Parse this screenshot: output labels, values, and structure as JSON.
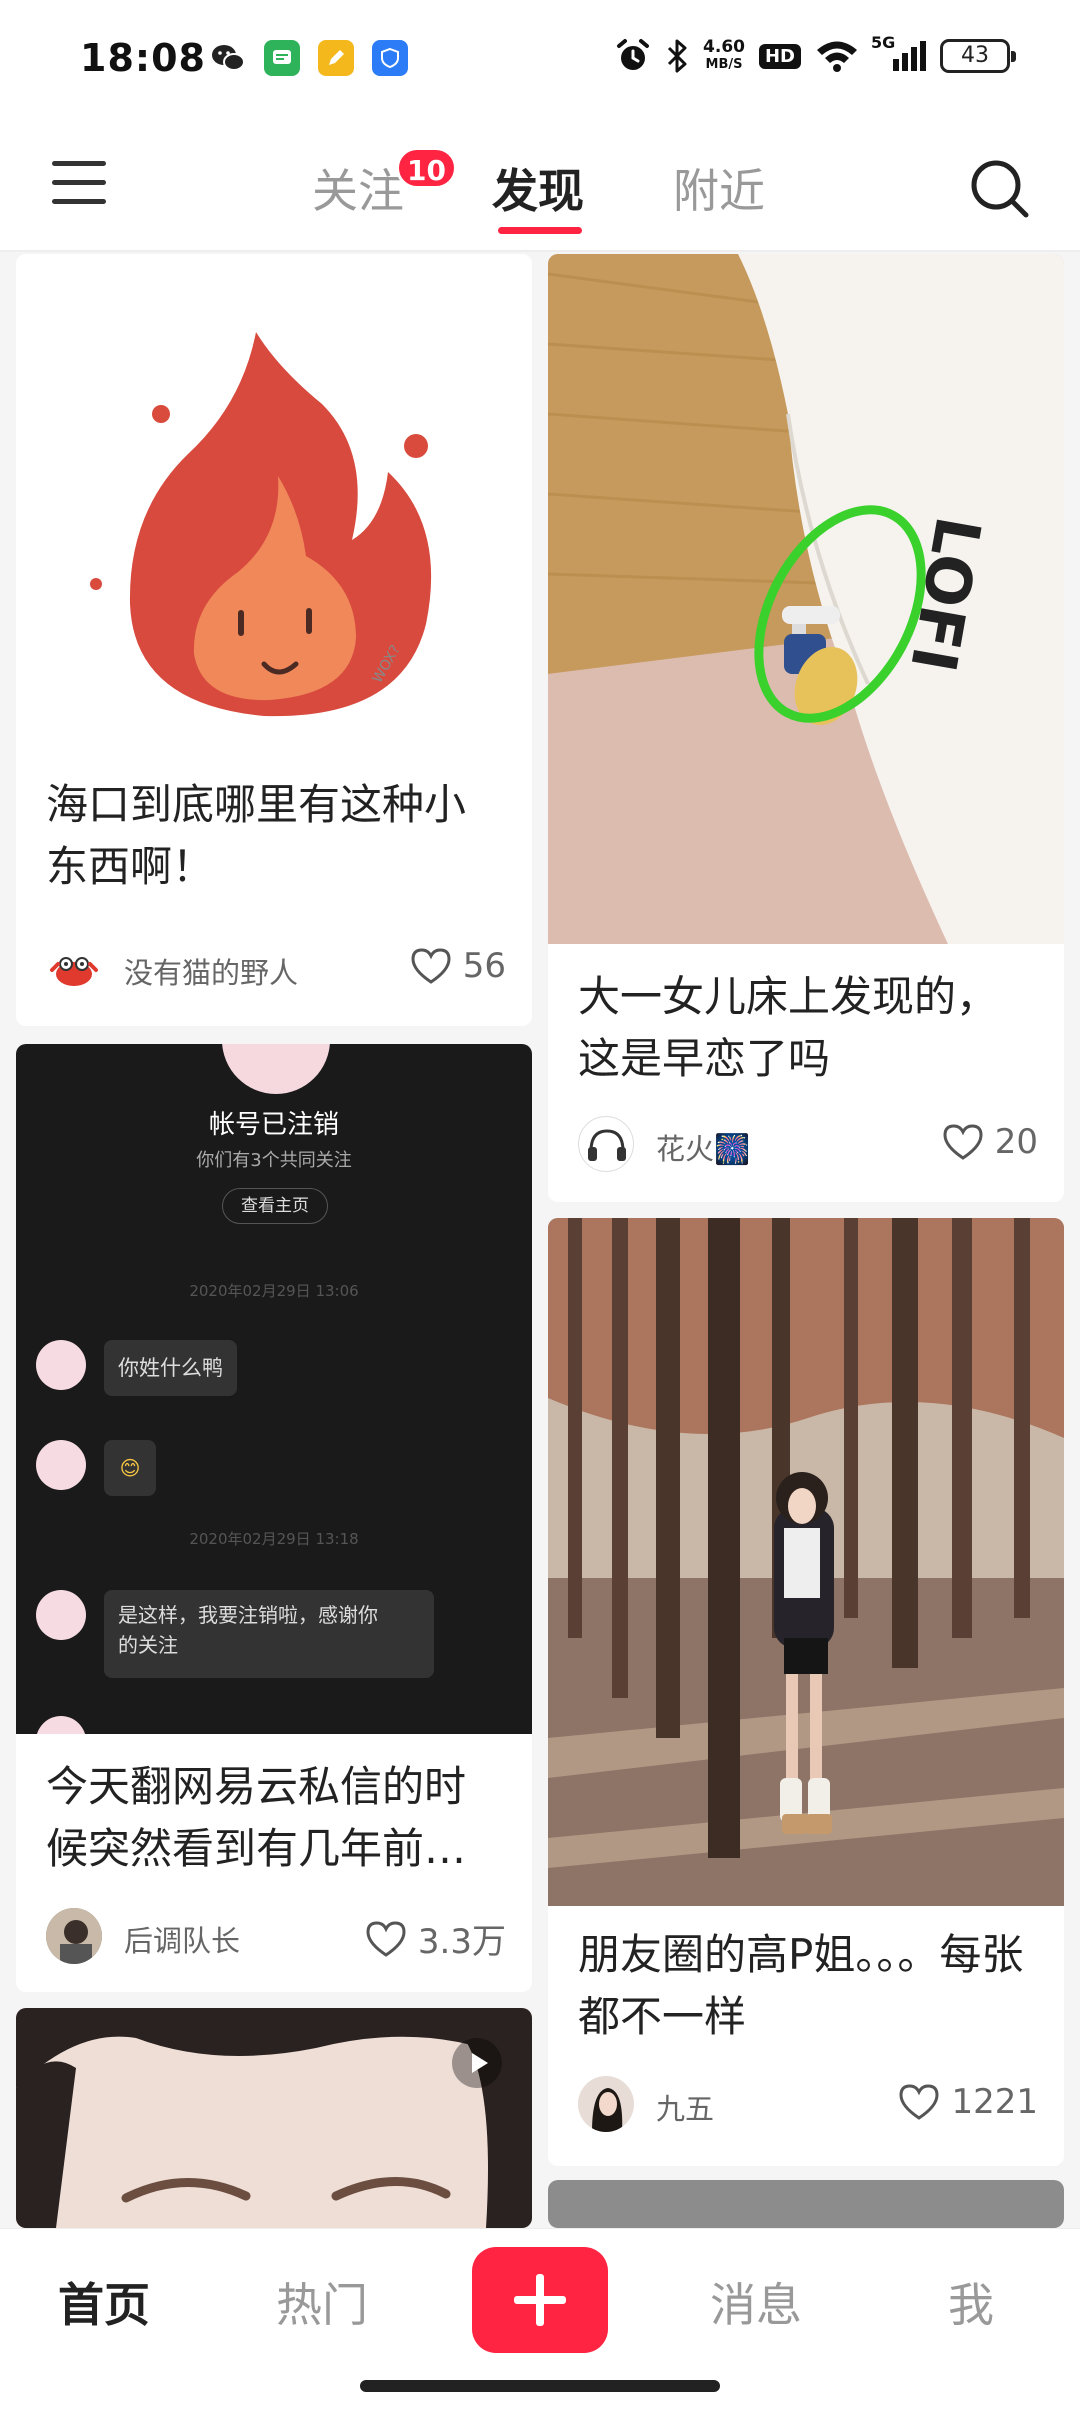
{
  "status_bar": {
    "time": "18:08",
    "net_speed_value": "4.60",
    "net_speed_unit": "MB/S",
    "hd_label": "HD",
    "signal_label": "5G",
    "battery": "43",
    "icons": [
      "wechat-icon",
      "messages-icon",
      "notes-icon",
      "security-icon",
      "alarm-icon",
      "bluetooth-icon",
      "wifi-icon",
      "signal-icon"
    ]
  },
  "header": {
    "tabs": [
      {
        "label": "关注",
        "badge": "10"
      },
      {
        "label": "发现",
        "active": true
      },
      {
        "label": "附近"
      }
    ],
    "accent": "#ff2442"
  },
  "feed": {
    "left": [
      {
        "title": "海口到底哪里有这种小东西啊！",
        "author": "没有猫的野人",
        "likes": "56",
        "image_signature": "WOX?"
      },
      {
        "title": "今天翻网易云私信的时候突然看到有几年前…",
        "author": "后调队长",
        "likes": "3.3万",
        "chat": {
          "header": "帐号已注销",
          "sub": "你们有3个共同关注",
          "button": "查看主页",
          "date1": "2020年02月29日 13:06",
          "msg1": "你姓什么鸭",
          "msg2": "😊",
          "date2": "2020年02月29日 13:18",
          "msg3_line1": "是这样，我要注销啦，感谢你",
          "msg3_line2": "的关注"
        }
      },
      {
        "video": true
      }
    ],
    "right": [
      {
        "title": "大一女儿床上发现的，这是早恋了吗",
        "author": "花火🎆",
        "likes": "20",
        "pillow_text": "LOFI"
      },
      {
        "title": "朋友圈的高P姐。。。每张都不一样",
        "author": "九五",
        "likes": "1221"
      }
    ]
  },
  "bottom_nav": {
    "items": [
      "首页",
      "热门",
      "消息",
      "我"
    ],
    "active": "首页"
  }
}
